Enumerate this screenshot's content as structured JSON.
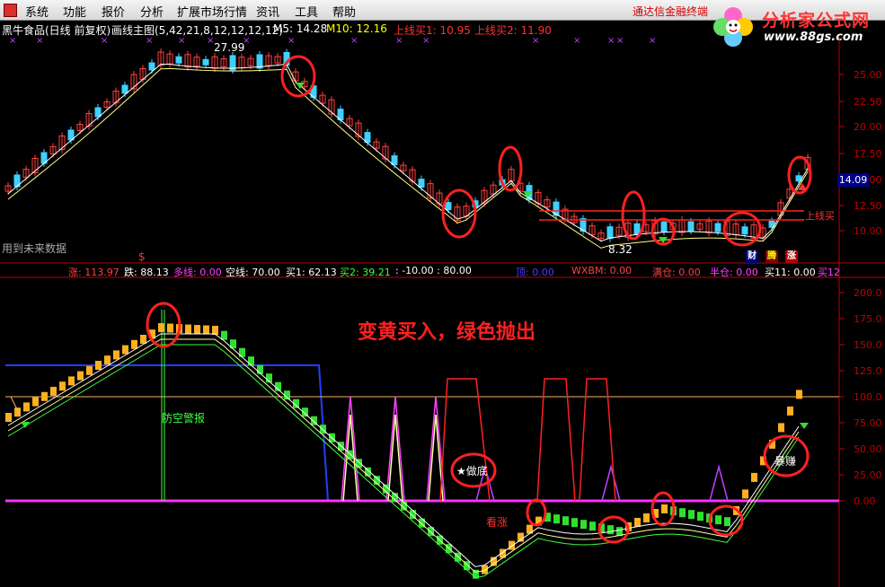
{
  "menu": {
    "items": [
      "系统",
      "功能",
      "报价",
      "分析",
      "扩展市场行情",
      "资讯",
      "工具",
      "帮助"
    ],
    "promo": "通达信金融终端"
  },
  "logo": {
    "title": "分析家公式网",
    "url": "www.88gs.com"
  },
  "header": {
    "stock": "黑牛食品(日线 前复权)",
    "chart_label": "画线主图(5,42,21,8,12,12,12,12)",
    "ma5": "M5: 14.28",
    "ma10": "M10: 12.16",
    "buy1": "上线买1: 10.95",
    "buy2": "上线买2: 11.90"
  },
  "main_panel": {
    "axis_ticks": [
      "25.00",
      "22.50",
      "20.00",
      "17.50",
      "15.00",
      "12.50",
      "10.00"
    ],
    "high_label": "27.99",
    "low_label": "8.32",
    "current_price": "14.09",
    "future_warning": "用到未来数据",
    "line_label": "上线买",
    "badges": [
      {
        "text": "财",
        "color": "#ffffff",
        "bg": "#000080"
      },
      {
        "text": "腾",
        "color": "#ffff00",
        "bg": "#800000"
      },
      {
        "text": "涨",
        "color": "#ffffff",
        "bg": "#b00000"
      }
    ],
    "dollar_mark": "$"
  },
  "indicator_header": [
    {
      "text": "涨: 113.97",
      "color": "#ff4040"
    },
    {
      "text": "跌: 88.13",
      "color": "#ffffff"
    },
    {
      "text": "多线: 0.00",
      "color": "#ff40ff"
    },
    {
      "text": "空线: 70.00",
      "color": "#ffffff"
    },
    {
      "text": "买1: 62.13",
      "color": "#ffffff"
    },
    {
      "text": "买2: 39.21",
      "color": "#40ff40"
    },
    {
      "text": ": -10.00 : 80.00",
      "color": "#ffffff"
    },
    {
      "text": "顶: 0.00",
      "color": "#4040ff"
    },
    {
      "text": "WXBM: 0.00",
      "color": "#ff4040"
    },
    {
      "text": "满仓: 0.00",
      "color": "#ff4040"
    },
    {
      "text": "半仓: 0.00",
      "color": "#ff40ff"
    },
    {
      "text": "买11: 0.00",
      "color": "#ffffff"
    },
    {
      "text": "买12",
      "color": "#ff40ff"
    }
  ],
  "indicator_panel": {
    "axis_ticks": [
      "200.0",
      "175.0",
      "150.0",
      "125.0",
      "100.0",
      "75.00",
      "50.00",
      "25.00",
      "0.00"
    ],
    "headline": "变黄买入，绿色抛出",
    "air_warning": "防空警报",
    "bottom_label": "★做底",
    "watch_label": "看涨",
    "profit_label": "暴赚"
  }
}
